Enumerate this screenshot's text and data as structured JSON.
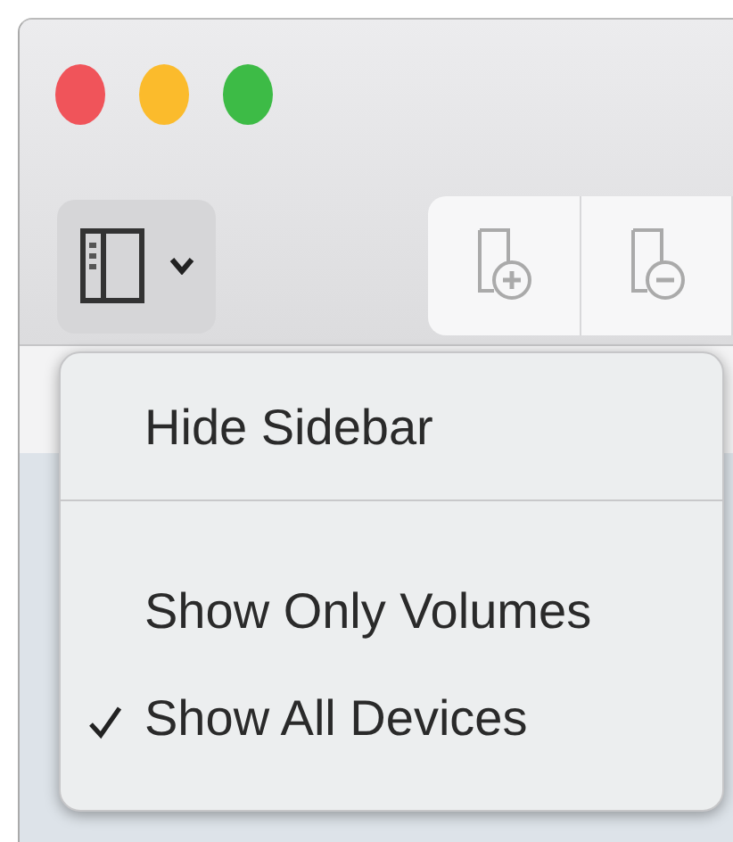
{
  "toolbar": {
    "sidebar_menu_open": true
  },
  "menu": {
    "items": [
      {
        "kind": "item",
        "label": "Hide Sidebar",
        "checked": false
      },
      {
        "kind": "separator"
      },
      {
        "kind": "item",
        "label": "Show Only Volumes",
        "checked": false
      },
      {
        "kind": "item",
        "label": "Show All Devices",
        "checked": true
      }
    ]
  }
}
